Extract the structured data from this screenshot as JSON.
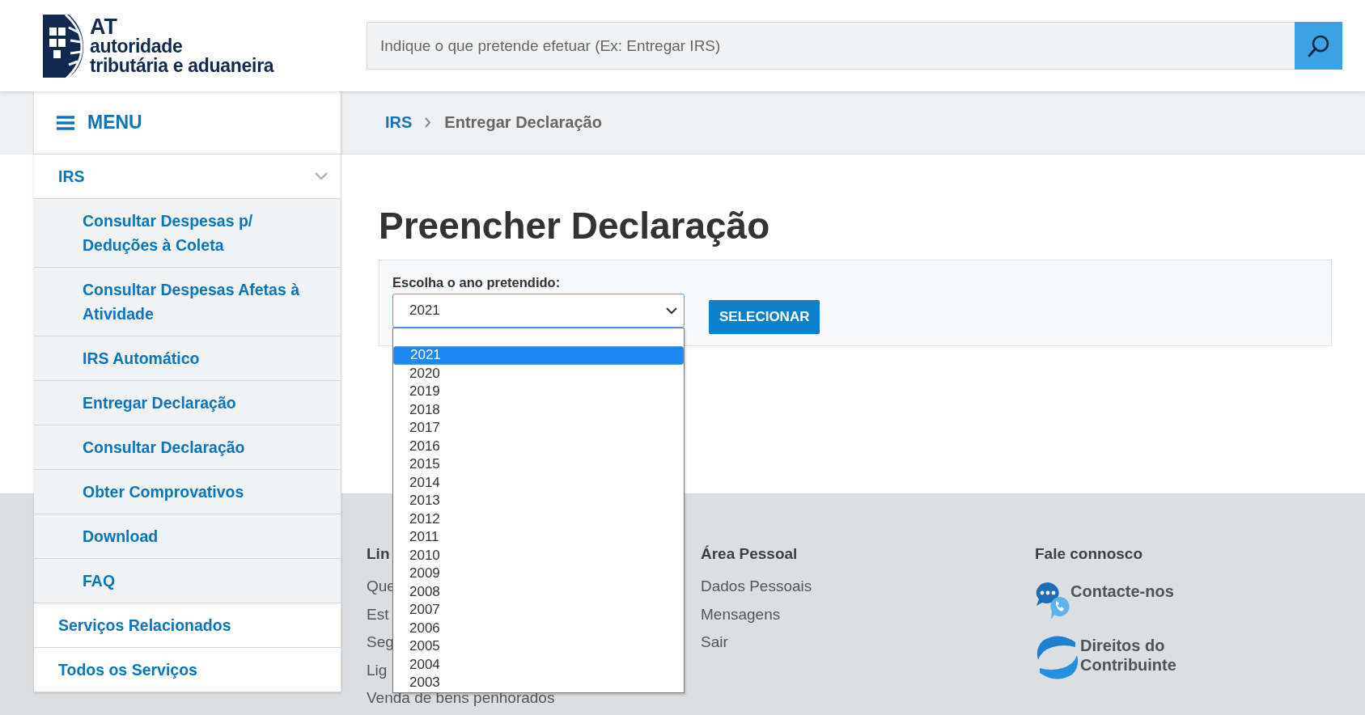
{
  "logo": {
    "abbr": "AT",
    "line1": "autoridade",
    "line2": "tributária e aduaneira"
  },
  "search": {
    "placeholder": "Indique o que pretende efetuar (Ex: Entregar IRS)"
  },
  "menu": {
    "label": "MENU"
  },
  "breadcrumb": [
    "IRS",
    "Entregar Declaração"
  ],
  "sidebar": {
    "items": [
      {
        "label": "IRS",
        "expanded": true,
        "children": [
          {
            "label": "Consultar Despesas p/ Deduções à Coleta"
          },
          {
            "label": "Consultar Despesas Afetas à Atividade"
          },
          {
            "label": "IRS Automático"
          },
          {
            "label": "Entregar Declaração"
          },
          {
            "label": "Consultar Declaração"
          },
          {
            "label": "Obter Comprovativos"
          },
          {
            "label": "Download"
          },
          {
            "label": "FAQ"
          }
        ]
      },
      {
        "label": "Serviços Relacionados"
      },
      {
        "label": "Todos os Serviços"
      }
    ]
  },
  "page_title": "Preencher Declaração",
  "form": {
    "label": "Escolha o ano pretendido:",
    "select_value": "2021",
    "button": "SELECIONAR",
    "expanded": true,
    "options": [
      {
        "label": "2021",
        "selected": true
      },
      {
        "label": "2020",
        "selected": false
      },
      {
        "label": "2019",
        "selected": false
      },
      {
        "label": "2018",
        "selected": false
      },
      {
        "label": "2017",
        "selected": false
      },
      {
        "label": "2016",
        "selected": false
      },
      {
        "label": "2015",
        "selected": false
      },
      {
        "label": "2014",
        "selected": false
      },
      {
        "label": "2013",
        "selected": false
      },
      {
        "label": "2012",
        "selected": false
      },
      {
        "label": "2011",
        "selected": false
      },
      {
        "label": "2010",
        "selected": false
      },
      {
        "label": "2009",
        "selected": false
      },
      {
        "label": "2008",
        "selected": false
      },
      {
        "label": "2007",
        "selected": false
      },
      {
        "label": "2006",
        "selected": false
      },
      {
        "label": "2005",
        "selected": false
      },
      {
        "label": "2004",
        "selected": false
      },
      {
        "label": "2003",
        "selected": false
      }
    ]
  },
  "footer": {
    "columns": [
      {
        "heading": "Lin",
        "links": [
          "Que",
          "Est",
          "Seg",
          "Lig",
          "Venda de bens penhorados"
        ]
      },
      {
        "heading": "Área Pessoal",
        "links": [
          "Dados Pessoais",
          "Mensagens",
          "Sair"
        ]
      },
      {
        "heading": "Fale connosco",
        "contacts": [
          {
            "kind": "chat",
            "label": "Contacte-nos"
          },
          {
            "kind": "rights",
            "label": "Direitos do Contribuinte"
          }
        ]
      }
    ]
  }
}
